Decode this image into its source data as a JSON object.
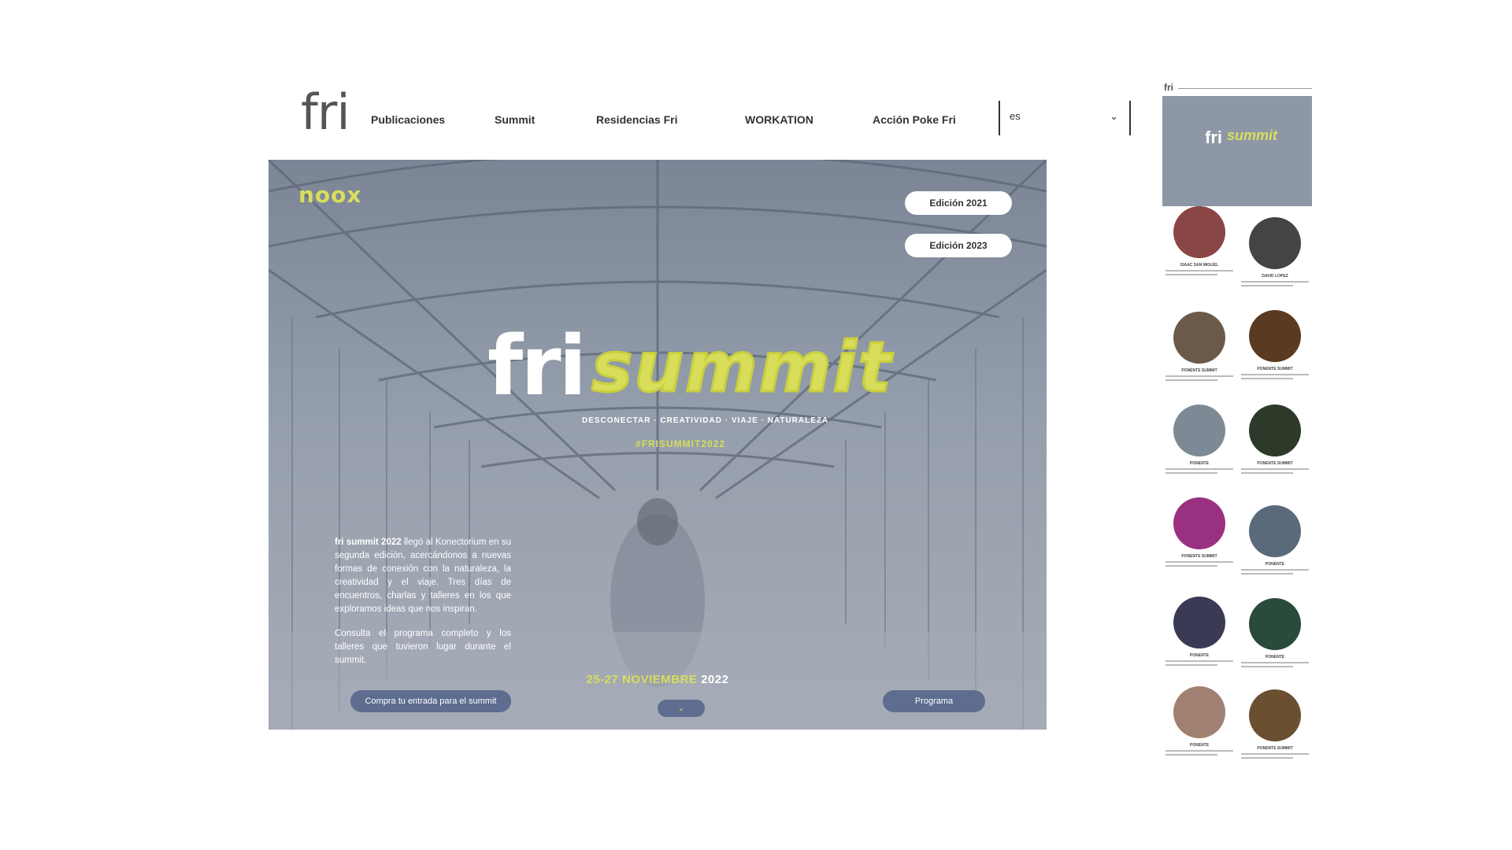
{
  "header": {
    "logo": "fri",
    "nav": [
      {
        "label": "Publicaciones"
      },
      {
        "label": "Summit"
      },
      {
        "label": "Residencias Fri"
      },
      {
        "label": "WORKATION"
      },
      {
        "label": "Acción Poke Fri"
      }
    ],
    "language": {
      "value": "es",
      "chevron": "⌄"
    }
  },
  "hero": {
    "sponsor_logo": "noox",
    "edition_buttons": [
      "Edición 2021",
      "Edición 2023"
    ],
    "brand_fri": "fri",
    "brand_summit": "summit",
    "tagline": "DESCONECTAR · CREATIVIDAD · VIAJE · NATURALEZA",
    "hashtag": "#FRISUMMIT2022",
    "intro_strong": "fri summit 2022",
    "intro_rest": " llegó al Konectorium en su segunda edición, acercándonos a nuevas formas de conexión con la naturaleza, la creatividad y el viaje. Tres días de encuentros, charlas y talleres en los que exploramos ideas que nos inspiran.",
    "intro_2": "Consulta el programa completo y los talleres que tuvieron lugar durante el summit.",
    "dates_highlight": "25-27 NOVIEMBRE",
    "dates_year": " 2022",
    "left_button": "Compra tu entrada para el summit",
    "right_button": "Programa",
    "down_button": "⌄"
  },
  "colors": {
    "accent": "#d8de5a",
    "pill": "#5d6c8f",
    "hero_bg": "#8e97a6"
  },
  "preview": {
    "mini_logo": "fri",
    "mini_fri": "fri",
    "mini_summit": "summit",
    "speakers": [
      {
        "name": "ISAAC SAN MIGUEL",
        "color": "#8a4545"
      },
      {
        "name": "DAVID LOPEZ",
        "color": "#444"
      },
      {
        "name": "PONENTE SUMMIT",
        "color": "#6b5a4a"
      },
      {
        "name": "PONENTE SUMMIT",
        "color": "#5a3a20"
      },
      {
        "name": "PONENTE",
        "color": "#7d8a95"
      },
      {
        "name": "PONENTE SUMMIT",
        "color": "#2d3a2a"
      },
      {
        "name": "PONENTE SUMMIT",
        "color": "#9a3080"
      },
      {
        "name": "PONENTE",
        "color": "#5a6a7a"
      },
      {
        "name": "PONENTE",
        "color": "#3a3a55"
      },
      {
        "name": "PONENTE",
        "color": "#2a4a3a"
      },
      {
        "name": "PONENTE",
        "color": "#a08070"
      },
      {
        "name": "PONENTE SUMMIT",
        "color": "#6a5030"
      }
    ]
  }
}
